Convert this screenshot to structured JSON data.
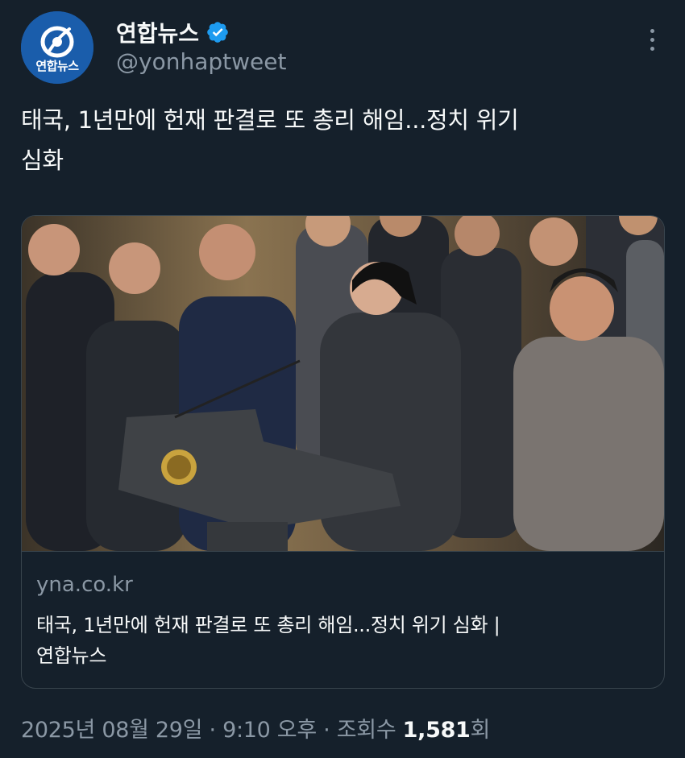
{
  "account": {
    "display_name": "연합뉴스",
    "handle": "@yonhaptweet",
    "avatar_label": "연합뉴스",
    "verified_icon": "verified-badge-icon",
    "brand_color": "#1a5dab",
    "verified_color": "#1d9bf0"
  },
  "tweet": {
    "line1": "태국, 1년만에 헌재 판결로 또 총리 해임...정치 위기",
    "line2": "심화"
  },
  "card": {
    "domain": "yna.co.kr",
    "title_line1": "태국, 1년만에 헌재 판결로 또 총리 해임...정치 위기 심화 |",
    "title_line2": "연합뉴스"
  },
  "footer": {
    "date": "2025년 08월 29일",
    "sep1": " · ",
    "time": "9:10 오후",
    "sep2": " · ",
    "views_label": "조회수 ",
    "views_count": "1,581",
    "views_suffix": "회"
  },
  "colors": {
    "background": "#15202b",
    "text": "#f7f9f9",
    "secondary_text": "#8b98a5",
    "border": "#38444d"
  }
}
